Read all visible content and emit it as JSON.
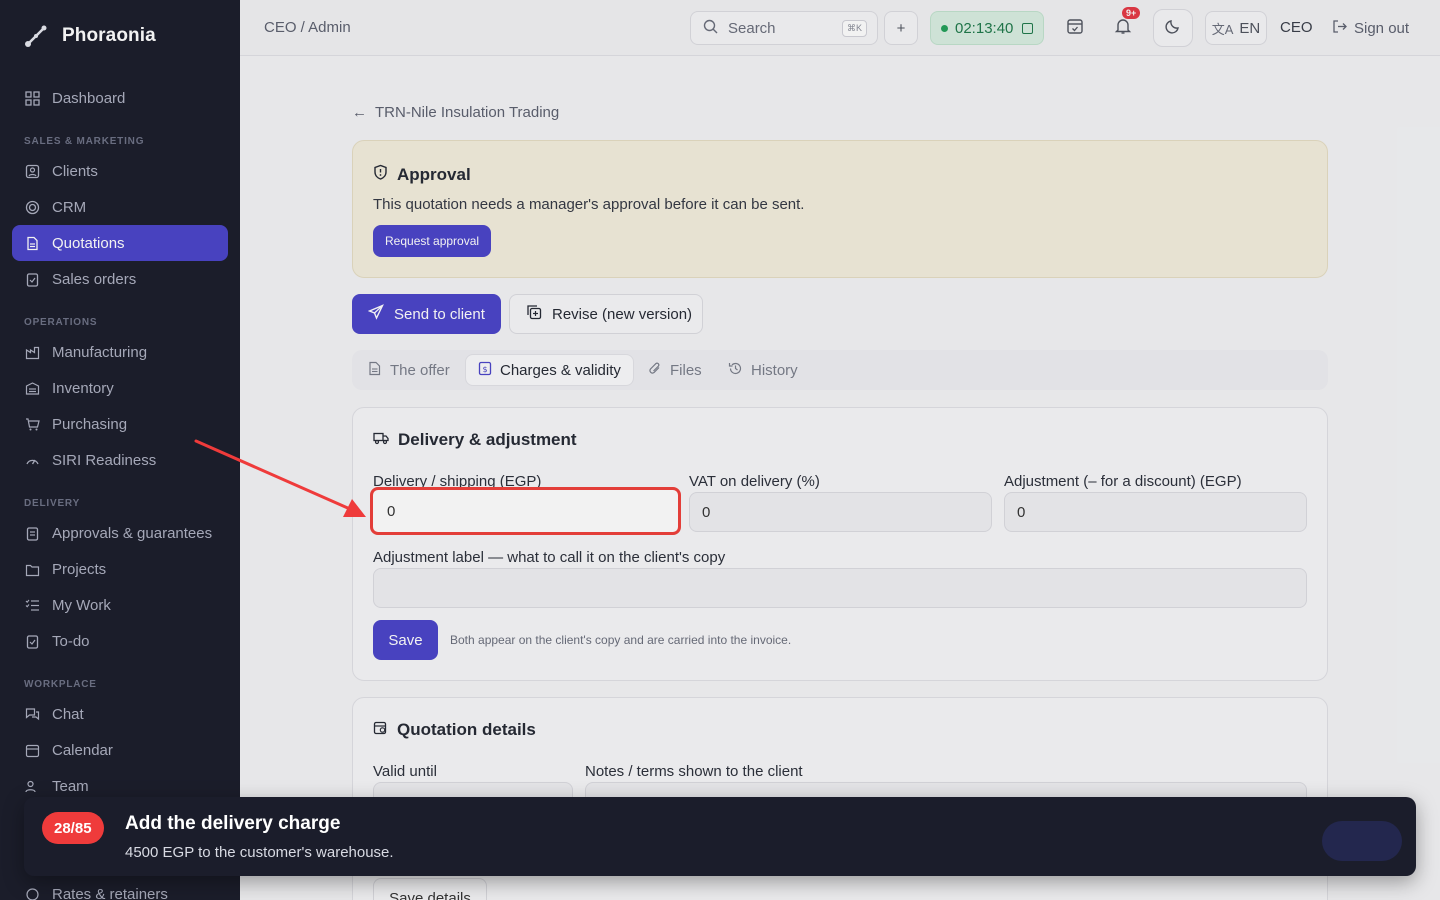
{
  "app": {
    "name": "Phoraonia"
  },
  "sidebar": {
    "items": [
      {
        "label": "Dashboard",
        "icon": "dashboard-icon"
      },
      {
        "label": "Clients",
        "icon": "clients-icon"
      },
      {
        "label": "CRM",
        "icon": "crm-icon"
      },
      {
        "label": "Quotations",
        "icon": "quotations-icon",
        "active": true
      },
      {
        "label": "Sales orders",
        "icon": "sales-orders-icon"
      },
      {
        "label": "Manufacturing",
        "icon": "manufacturing-icon"
      },
      {
        "label": "Inventory",
        "icon": "inventory-icon"
      },
      {
        "label": "Purchasing",
        "icon": "cart-icon"
      },
      {
        "label": "SIRI Readiness",
        "icon": "readiness-icon"
      },
      {
        "label": "Approvals & guarantees",
        "icon": "approvals-icon"
      },
      {
        "label": "Projects",
        "icon": "projects-icon"
      },
      {
        "label": "My Work",
        "icon": "my-work-icon"
      },
      {
        "label": "To-do",
        "icon": "todo-icon"
      },
      {
        "label": "Chat",
        "icon": "chat-icon"
      },
      {
        "label": "Calendar",
        "icon": "calendar-icon"
      },
      {
        "label": "Team",
        "icon": "team-icon"
      },
      {
        "label": "Rates & retainers",
        "icon": "rates-icon"
      }
    ],
    "sections": {
      "sales": "SALES & MARKETING",
      "operations": "OPERATIONS",
      "delivery": "DELIVERY",
      "workplace": "WORKPLACE"
    }
  },
  "topbar": {
    "breadcrumb": "CEO / Admin",
    "search_placeholder": "Search",
    "search_shortcut": "⌘K",
    "timer": "02:13:40",
    "notif_badge": "9+",
    "language": "EN",
    "role": "CEO",
    "signout": "Sign out"
  },
  "main": {
    "back_label": "TRN-Nile Insulation Trading",
    "approval": {
      "title": "Approval",
      "desc": "This quotation needs a manager's approval before it can be sent.",
      "button": "Request approval"
    },
    "actions": {
      "send": "Send to client",
      "revise": "Revise (new version)"
    },
    "tabs": [
      "The offer",
      "Charges & validity",
      "Files",
      "History"
    ],
    "delivery_card": {
      "title": "Delivery & adjustment",
      "delivery_label": "Delivery / shipping (EGP)",
      "delivery_value": "0",
      "vat_label": "VAT on delivery (%)",
      "vat_value": "0",
      "adjustment_label": "Adjustment (– for a discount) (EGP)",
      "adjustment_value": "0",
      "adj_name_label": "Adjustment label — what to call it on the client's copy",
      "adj_name_value": "",
      "save": "Save",
      "hint": "Both appear on the client's copy and are carried into the invoice."
    },
    "details_card": {
      "title": "Quotation details",
      "valid_label": "Valid until",
      "notes_label": "Notes / terms shown to the client",
      "save_details": "Save details"
    }
  },
  "task": {
    "step": "28/85",
    "title": "Add the delivery charge",
    "subtitle": "4500 EGP to the customer's warehouse."
  },
  "colors": {
    "accent": "#4b45c9",
    "highlight": "#f0403b",
    "sidebar": "#1b1d2b"
  }
}
